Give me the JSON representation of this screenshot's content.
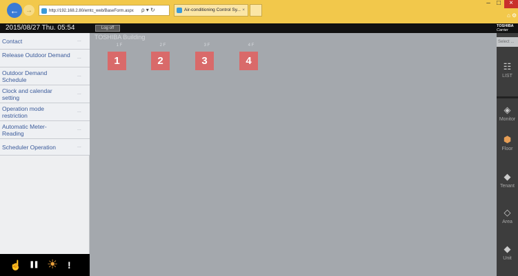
{
  "browser": {
    "back_icon": "arrow-left-icon",
    "address": "http://192.168.2.80/emtc_web/BaseForm.aspx",
    "addr_controls": "ρ ▾ ↻",
    "tab_title": "Air-conditioning Control Sy...",
    "tab_close": "×",
    "min": "–",
    "max": "□",
    "close": "×",
    "tools": "⌂ ⚙"
  },
  "header": {
    "datetime": "2015/08/27  Thu.  05:54",
    "logoff_label": "Log off",
    "brand_line1": "TOSHIBA",
    "brand_line2": "Carrier"
  },
  "sidebar": {
    "items": [
      {
        "label": "Contact",
        "dots": "..."
      },
      {
        "label": "Release Outdoor Demand",
        "dots": "..."
      },
      {
        "label": "Outdoor Demand Schedule",
        "dots": "..."
      },
      {
        "label": "Clock and calendar setting",
        "dots": "..."
      },
      {
        "label": "Operation mode restriction",
        "dots": "..."
      },
      {
        "label": "Automatic Meter-Reading",
        "dots": "..."
      },
      {
        "label": "Scheduler Operation",
        "dots": "..."
      }
    ],
    "tools": [
      {
        "icon": "hand-pointer-icon",
        "glyph": "☝"
      },
      {
        "icon": "pause-icon",
        "glyph": "❚❚"
      },
      {
        "icon": "sun-icon",
        "glyph": "☀"
      },
      {
        "icon": "alert-icon",
        "glyph": "!"
      }
    ]
  },
  "main": {
    "title": "TOSHIBA Building",
    "floors": [
      {
        "label": "1 F",
        "number": "1"
      },
      {
        "label": "2 F",
        "number": "2"
      },
      {
        "label": "3 F",
        "number": "3"
      },
      {
        "label": "4 F",
        "number": "4"
      }
    ]
  },
  "right_panel": {
    "select": "Select ...",
    "items": [
      {
        "label": "LIST",
        "glyph": "☷"
      },
      {
        "label": "Monitor",
        "glyph": "◈"
      },
      {
        "label": "Floor",
        "glyph": "⬢"
      },
      {
        "label": "Tenant",
        "glyph": "◆"
      },
      {
        "label": "Area",
        "glyph": "◇"
      },
      {
        "label": "Unit",
        "glyph": "◆"
      }
    ]
  },
  "colors": {
    "browser_bar": "#f2c84b",
    "floor_button": "#d96a6a",
    "main_bg": "#a4a8ad",
    "menu_text": "#3a5a9a"
  }
}
